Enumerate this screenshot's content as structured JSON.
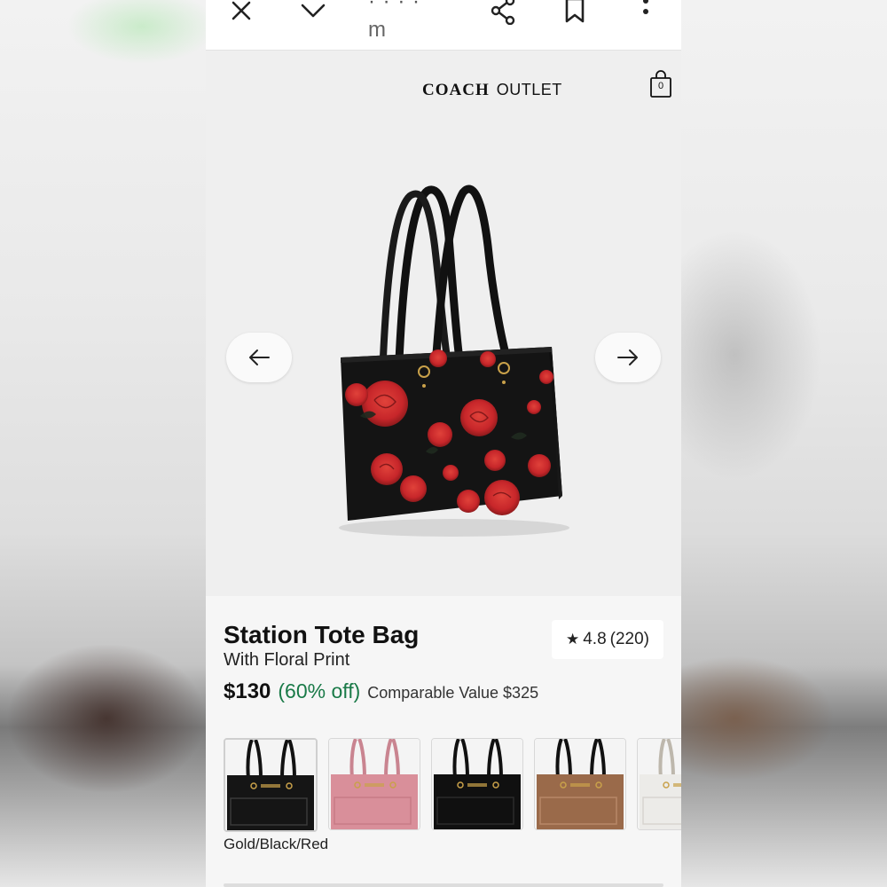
{
  "toolbar": {
    "url_fragment": "· · · ·",
    "url_sub": "m",
    "icons": [
      "close-icon",
      "chevron-down-icon",
      "share-icon",
      "bookmark-icon",
      "more-vert-icon"
    ]
  },
  "header": {
    "brand_main": "COACH",
    "brand_sub": "OUTLET",
    "cart_count": "0"
  },
  "carousel": {
    "prev_icon": "arrow-left-icon",
    "next_icon": "arrow-right-icon"
  },
  "product": {
    "title": "Station Tote Bag",
    "subtitle": "With Floral Print",
    "rating": "4.8",
    "reviews": "(220)",
    "price": "$130",
    "discount": "(60% off)",
    "comparable": "Comparable Value $325",
    "selected_color": "Gold/Black/Red"
  },
  "swatches": [
    {
      "color": "#151515",
      "accent": "#3a3a3a"
    },
    {
      "color": "#d98f9a",
      "accent": "#c77b86"
    },
    {
      "color": "#101010",
      "accent": "#2a2a2a"
    },
    {
      "color": "#9a6a4a",
      "accent": "#b78868"
    },
    {
      "color": "#ecebe8",
      "accent": "#d8d5cf"
    }
  ],
  "colors": {
    "discount_green": "#1a7a48",
    "bag_black": "#141414",
    "rose_red": "#c9282a"
  }
}
